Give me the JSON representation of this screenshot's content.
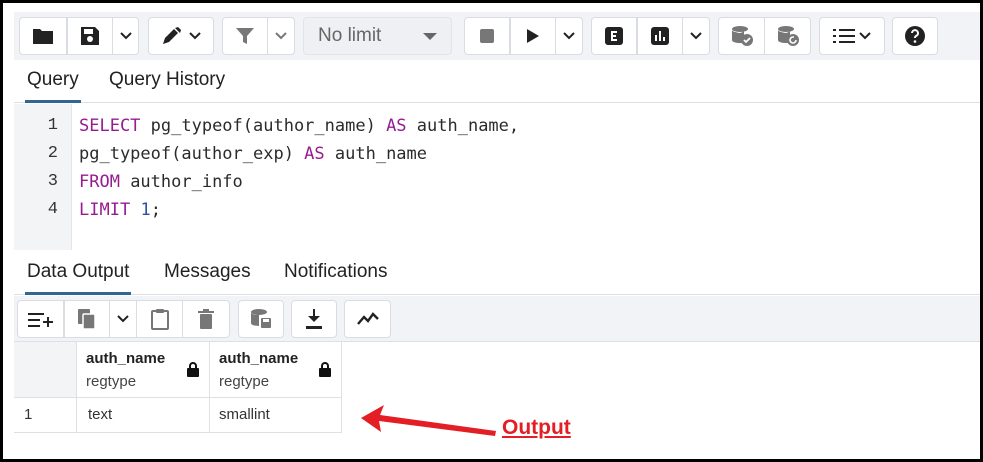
{
  "toolbar": {
    "limit_select_value": "No limit",
    "buttons": [
      {
        "name": "open-file",
        "icon": "folder-icon"
      },
      {
        "name": "save",
        "icon": "save-icon"
      },
      {
        "name": "edit",
        "icon": "pencil-icon"
      },
      {
        "name": "filter",
        "icon": "filter-icon"
      },
      {
        "name": "stop",
        "icon": "stop-icon"
      },
      {
        "name": "execute",
        "icon": "play-icon"
      },
      {
        "name": "explain",
        "icon": "explain-icon"
      },
      {
        "name": "explain-analyze",
        "icon": "chart-icon"
      },
      {
        "name": "commit",
        "icon": "db-check-icon"
      },
      {
        "name": "rollback",
        "icon": "db-undo-icon"
      },
      {
        "name": "macros",
        "icon": "list-icon"
      },
      {
        "name": "help",
        "icon": "help-icon"
      }
    ]
  },
  "query_tabs": [
    "Query",
    "Query History"
  ],
  "editor": {
    "lines": [
      {
        "no": "1"
      },
      {
        "no": "2"
      },
      {
        "no": "3"
      },
      {
        "no": "4"
      }
    ],
    "tokens": {
      "l1_kw1": "SELECT",
      "l1_t1": " pg_typeof(author_name) ",
      "l1_kw2": "AS",
      "l1_t2": " auth_name,",
      "l2_t1": "pg_typeof(author_exp) ",
      "l2_kw1": "AS",
      "l2_t2": " auth_name",
      "l3_kw1": "FROM",
      "l3_t1": " author_info",
      "l4_kw1": "LIMIT",
      "l4_t1": " ",
      "l4_num": "1",
      "l4_t2": ";"
    }
  },
  "output_tabs": [
    "Data Output",
    "Messages",
    "Notifications"
  ],
  "grid": {
    "columns": [
      {
        "name": "auth_name",
        "type": "regtype"
      },
      {
        "name": "auth_name",
        "type": "regtype"
      }
    ],
    "rows": [
      {
        "row_no": "1",
        "cells": [
          "text",
          "smallint"
        ]
      }
    ]
  },
  "annotation": {
    "label": "Output",
    "color": "#e31e24"
  },
  "colors": {
    "keyword": "#961c91",
    "active_tab_underline": "#326690"
  }
}
